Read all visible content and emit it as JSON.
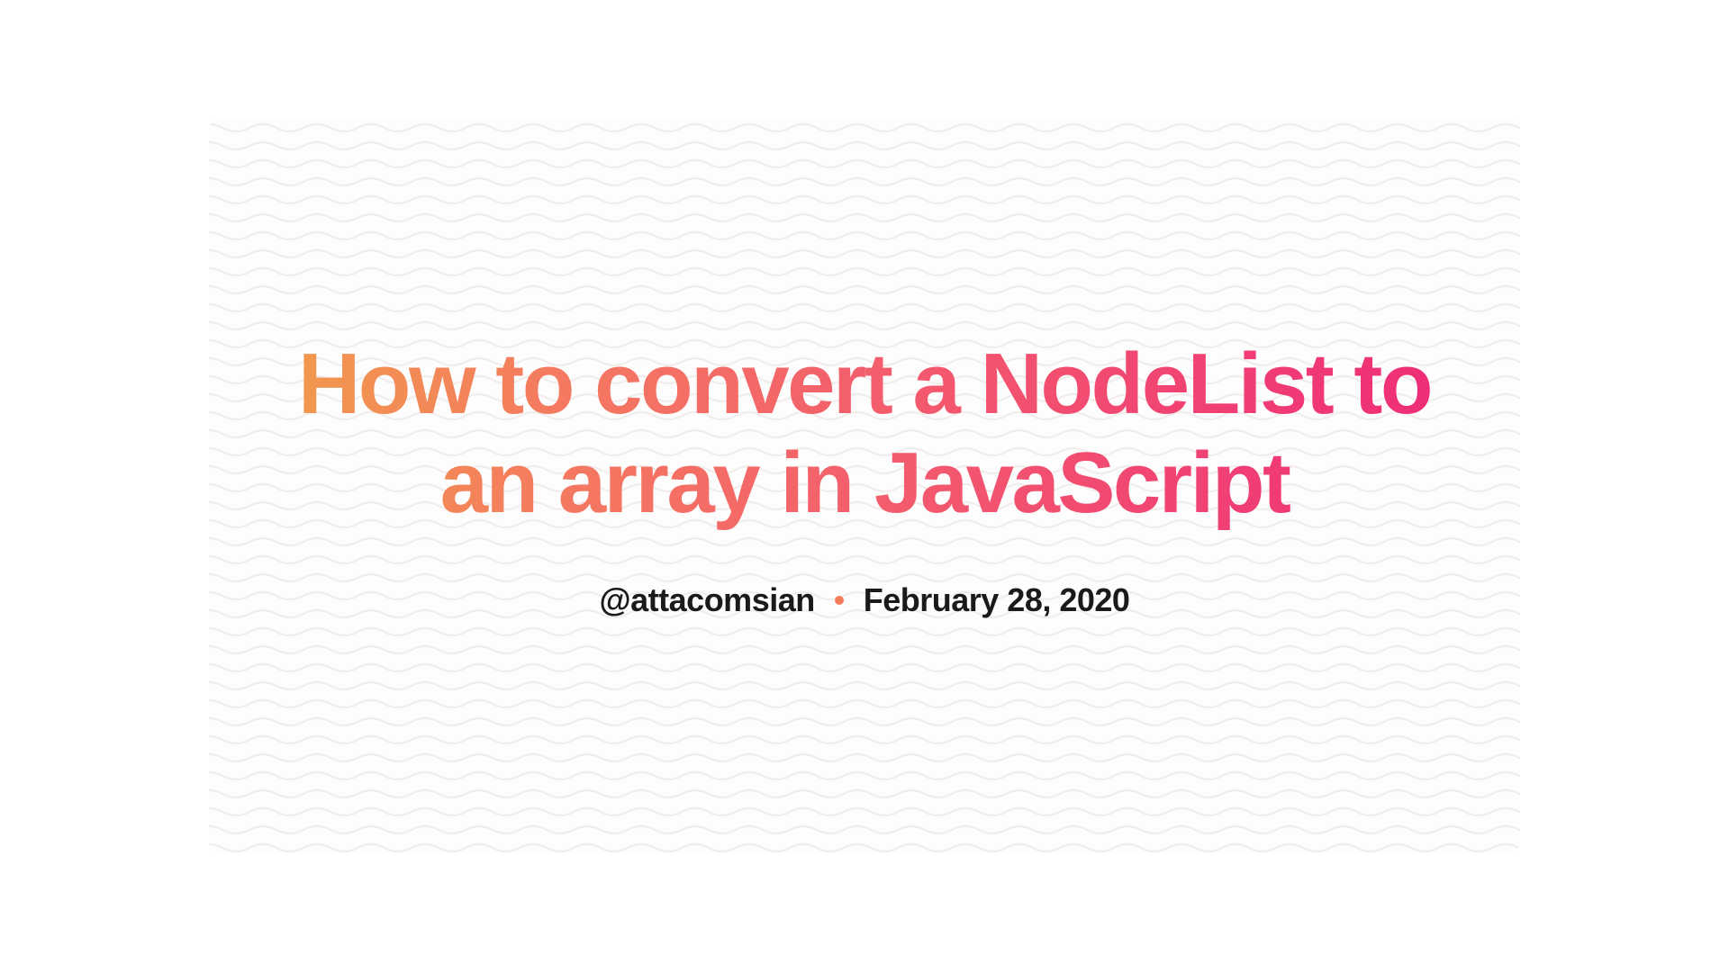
{
  "title": "How to convert a NodeList to an array in JavaScript",
  "author_handle": "@attacomsian",
  "date": "February 28, 2020",
  "colors": {
    "gradient_start": "#f29b4c",
    "gradient_end": "#ee2b78",
    "bullet": "#f57c5a",
    "text_dark": "#1a1a1a",
    "card_bg": "#fefdfd",
    "wave_stroke": "#f1edec"
  }
}
